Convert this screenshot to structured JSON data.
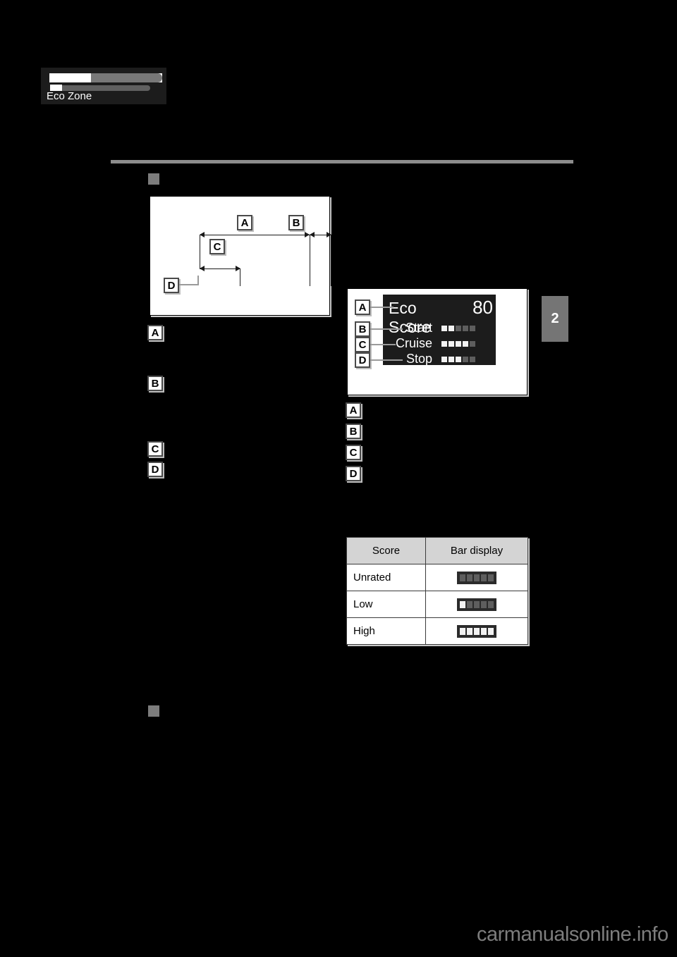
{
  "page": {
    "chapter_tab": "2",
    "watermark": "carmanualsonline.info"
  },
  "figure_eco_driving": {
    "name": "eco-driving-bar-graph",
    "callouts": [
      "A",
      "B",
      "C",
      "D"
    ],
    "zone_label": "Eco Zone"
  },
  "figure_eco_score": {
    "name": "eco-score-display",
    "title": "Eco Score",
    "score": "80",
    "callouts": [
      "A",
      "B",
      "C",
      "D"
    ],
    "rows": [
      {
        "label": "Start",
        "lit": 2,
        "total": 5
      },
      {
        "label": "Cruise",
        "lit": 4,
        "total": 5
      },
      {
        "label": "Stop",
        "lit": 3,
        "total": 5
      }
    ]
  },
  "left_callouts": [
    "A",
    "B",
    "C",
    "D"
  ],
  "right_callouts": [
    "A",
    "B",
    "C",
    "D"
  ],
  "score_table": {
    "headers": [
      "Score",
      "Bar display"
    ],
    "rows": [
      {
        "score": "Unrated",
        "lit": 0,
        "total": 5
      },
      {
        "score": "Low",
        "lit": 1,
        "total": 5
      },
      {
        "score": "High",
        "lit": 5,
        "total": 5
      }
    ]
  },
  "colors": {
    "page_background": "#000000",
    "rule": "#8c8c8c",
    "tab": "#757575",
    "screen": "#1c1c1c",
    "segment_on": "#f2f2f2",
    "segment_off": "#5e5e5e",
    "table_header": "#d4d4d4",
    "watermark": "#7d7d7d"
  }
}
